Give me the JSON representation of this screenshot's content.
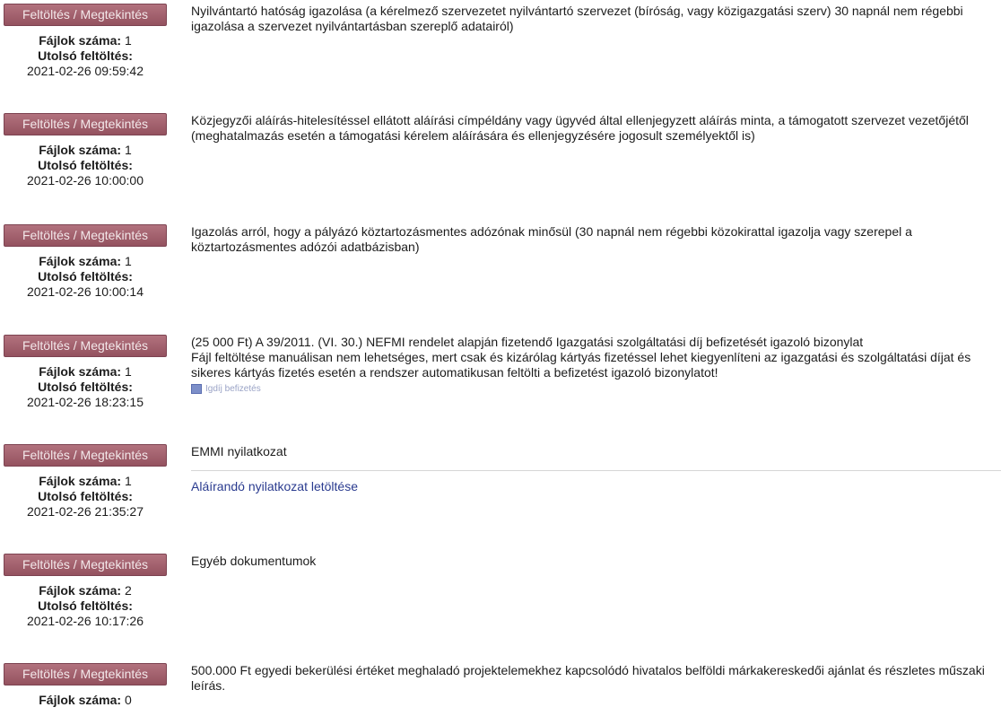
{
  "button_label": "Feltöltés / Megtekintés",
  "files_label": "Fájlok száma:",
  "uploaded_label": "Utolsó feltöltés:",
  "rows": [
    {
      "count": "1",
      "last_upload": "2021-02-26 09:59:42",
      "lines": [
        "Nyilvántartó hatóság igazolása (a kérelmező szervezetet nyilvántartó szervezet (bíróság, vagy közigazgatási szerv) 30 napnál nem régebbi igazolása a szervezet nyilvántartásban szereplő adatairól)"
      ]
    },
    {
      "count": "1",
      "last_upload": "2021-02-26 10:00:00",
      "lines": [
        "Közjegyzői aláírás-hitelesítéssel ellátott aláírási címpéldány vagy ügyvéd által ellenjegyzett aláírás minta, a támogatott szervezet vezetőjétől (meghatalmazás esetén a támogatási kérelem aláírására és ellenjegyzésére jogosult személyektől is)"
      ]
    },
    {
      "count": "1",
      "last_upload": "2021-02-26 10:00:14",
      "lines": [
        "Igazolás arról, hogy a pályázó köztartozásmentes adózónak minősül (30 napnál nem régebbi közokirattal igazolja vagy szerepel a köztartozásmentes adózói adatbázisban)"
      ]
    },
    {
      "count": "1",
      "last_upload": "2021-02-26 18:23:15",
      "lines": [
        "(25 000 Ft) A 39/2011. (VI. 30.) NEFMI rendelet alapján fizetendő Igazgatási szolgáltatási díj befizetését igazoló bizonylat",
        "Fájl feltöltése manuálisan nem lehetséges, mert csak és kizárólag kártyás fizetéssel lehet kiegyenlíteni az igazgatási és szolgáltatási díjat és sikeres kártyás fizetés esetén a rendszer automatikusan feltölti a befizetést igazoló bizonylatot!"
      ],
      "image_caption": "Igdíj befizetés"
    },
    {
      "count": "1",
      "last_upload": "2021-02-26 21:35:27",
      "lines": [
        "EMMI nyilatkozat"
      ],
      "link": "Aláírandó nyilatkozat letöltése"
    },
    {
      "count": "2",
      "last_upload": "2021-02-26 10:17:26",
      "lines": [
        "Egyéb dokumentumok"
      ]
    },
    {
      "count": "0",
      "last_upload": "",
      "lines": [
        "500.000 Ft egyedi bekerülési értéket meghaladó projektelemekhez kapcsolódó hivatalos belföldi márkakereskedői ajánlat és részletes műszaki leírás."
      ]
    }
  ]
}
